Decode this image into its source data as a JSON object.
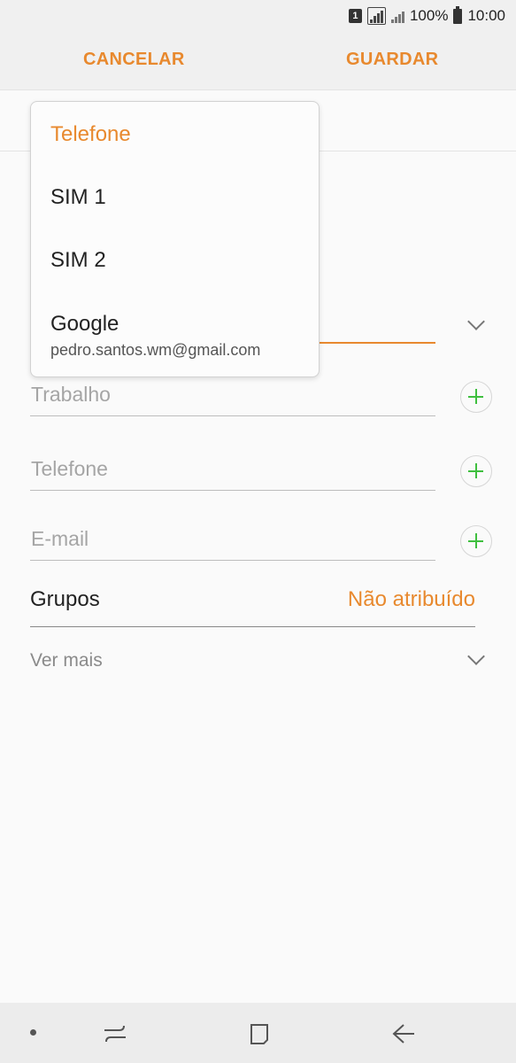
{
  "status_bar": {
    "sim_label": "1",
    "battery_text": "100%",
    "time": "10:00"
  },
  "action_bar": {
    "cancel_label": "CANCELAR",
    "save_label": "GUARDAR"
  },
  "dropdown": {
    "items": [
      {
        "label": "Telefone",
        "selected": true
      },
      {
        "label": "SIM 1"
      },
      {
        "label": "SIM 2"
      },
      {
        "label": "Google",
        "sub": "pedro.santos.wm@gmail.com"
      }
    ]
  },
  "form": {
    "work_placeholder": "Trabalho",
    "phone_placeholder": "Telefone",
    "email_placeholder": "E-mail",
    "groups_label": "Grupos",
    "groups_value": "Não atribuído",
    "see_more": "Ver mais"
  },
  "colors": {
    "accent": "#e8892e",
    "add_green": "#3fbf3f"
  }
}
